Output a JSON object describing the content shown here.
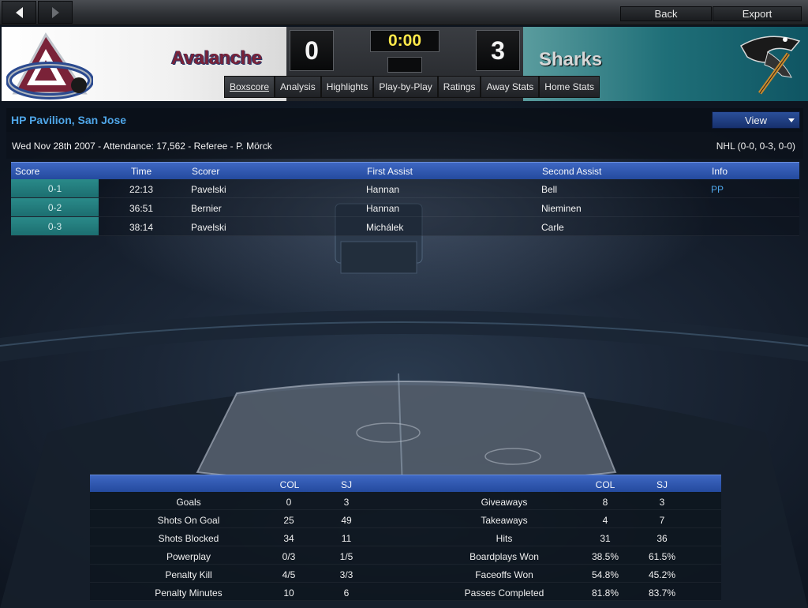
{
  "toolbar": {
    "back_label": "Back",
    "export_label": "Export"
  },
  "scoreboard": {
    "home_team": "Avalanche",
    "away_team": "Sharks",
    "home_score": "0",
    "away_score": "3",
    "clock": "0:00",
    "home_color": "#7a2238",
    "away_color": "#1f6f78"
  },
  "tabs": [
    {
      "label": "Boxscore",
      "active": true
    },
    {
      "label": "Analysis"
    },
    {
      "label": "Highlights"
    },
    {
      "label": "Play-by-Play"
    },
    {
      "label": "Ratings"
    },
    {
      "label": "Away Stats"
    },
    {
      "label": "Home Stats"
    }
  ],
  "venue": {
    "name": "HP Pavilion, San Jose",
    "view_label": "View",
    "details": "Wed Nov 28th 2007 - Attendance: 17,562 - Referee - P. Mörck",
    "league_summary": "NHL (0-0, 0-3, 0-0)"
  },
  "goals": {
    "headers": {
      "score": "Score",
      "time": "Time",
      "scorer": "Scorer",
      "first_assist": "First Assist",
      "second_assist": "Second Assist",
      "info": "Info"
    },
    "rows": [
      {
        "score": "0-1",
        "time": "22:13",
        "scorer": "Pavelski",
        "first_assist": "Hannan",
        "second_assist": "Bell",
        "info": "PP"
      },
      {
        "score": "0-2",
        "time": "36:51",
        "scorer": "Bernier",
        "first_assist": "Hannan",
        "second_assist": "Nieminen",
        "info": ""
      },
      {
        "score": "0-3",
        "time": "38:14",
        "scorer": "Pavelski",
        "first_assist": "Michálek",
        "second_assist": "Carle",
        "info": ""
      }
    ]
  },
  "stats": {
    "headers": {
      "col": "COL",
      "sj": "SJ"
    },
    "rows": [
      {
        "left_label": "Goals",
        "left_col": "0",
        "left_sj": "3",
        "right_label": "Giveaways",
        "right_col": "8",
        "right_sj": "3"
      },
      {
        "left_label": "Shots On Goal",
        "left_col": "25",
        "left_sj": "49",
        "right_label": "Takeaways",
        "right_col": "4",
        "right_sj": "7"
      },
      {
        "left_label": "Shots Blocked",
        "left_col": "34",
        "left_sj": "11",
        "right_label": "Hits",
        "right_col": "31",
        "right_sj": "36"
      },
      {
        "left_label": "Powerplay",
        "left_col": "0/3",
        "left_sj": "1/5",
        "right_label": "Boardplays Won",
        "right_col": "38.5%",
        "right_sj": "61.5%"
      },
      {
        "left_label": "Penalty Kill",
        "left_col": "4/5",
        "left_sj": "3/3",
        "right_label": "Faceoffs Won",
        "right_col": "54.8%",
        "right_sj": "45.2%"
      },
      {
        "left_label": "Penalty Minutes",
        "left_col": "10",
        "left_sj": "6",
        "right_label": "Passes Completed",
        "right_col": "81.8%",
        "right_sj": "83.7%"
      }
    ]
  }
}
